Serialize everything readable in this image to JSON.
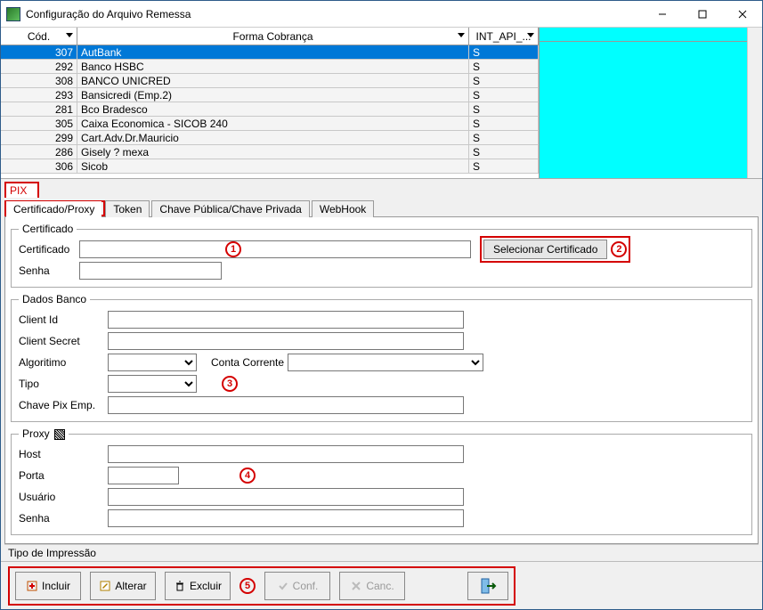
{
  "window": {
    "title": "Configuração do Arquivo Remessa"
  },
  "grid": {
    "headers": {
      "cod": "Cód.",
      "forma": "Forma Cobrança",
      "api": "INT_API_..."
    },
    "rows": [
      {
        "cod": "307",
        "forma": "AutBank",
        "api": "S",
        "selected": true
      },
      {
        "cod": "292",
        "forma": "Banco HSBC",
        "api": "S"
      },
      {
        "cod": "308",
        "forma": "BANCO UNICRED",
        "api": "S"
      },
      {
        "cod": "293",
        "forma": "Bansicredi (Emp.2)",
        "api": "S"
      },
      {
        "cod": "281",
        "forma": "Bco Bradesco",
        "api": "S"
      },
      {
        "cod": "305",
        "forma": "Caixa Economica - SICOB 240",
        "api": "S"
      },
      {
        "cod": "299",
        "forma": "Cart.Adv.Dr.Mauricio",
        "api": "S"
      },
      {
        "cod": "286",
        "forma": "Gisely ? mexa",
        "api": "S"
      },
      {
        "cod": "306",
        "forma": "Sicob",
        "api": "S"
      }
    ]
  },
  "outer_tab": "PIX",
  "tabs": [
    {
      "label": "Certificado/Proxy",
      "active": true
    },
    {
      "label": "Token"
    },
    {
      "label": "Chave Pública/Chave Privada"
    },
    {
      "label": "WebHook"
    }
  ],
  "certificado": {
    "legend": "Certificado",
    "cert_label": "Certificado",
    "senha_label": "Senha",
    "select_btn": "Selecionar Certificado"
  },
  "dados": {
    "legend": "Dados Banco",
    "client_id": "Client Id",
    "client_secret": "Client Secret",
    "algoritimo": "Algoritimo",
    "conta": "Conta Corrente",
    "tipo": "Tipo",
    "chave": "Chave Pix Emp."
  },
  "proxy": {
    "legend": "Proxy",
    "host": "Host",
    "porta": "Porta",
    "usuario": "Usuário",
    "senha": "Senha"
  },
  "tipo_impressao": "Tipo de Impressão",
  "toolbar": {
    "incluir": "Incluir",
    "alterar": "Alterar",
    "excluir": "Excluir",
    "conf": "Conf.",
    "canc": "Canc."
  },
  "callouts": {
    "c1": "1",
    "c2": "2",
    "c3": "3",
    "c4": "4",
    "c5": "5"
  }
}
